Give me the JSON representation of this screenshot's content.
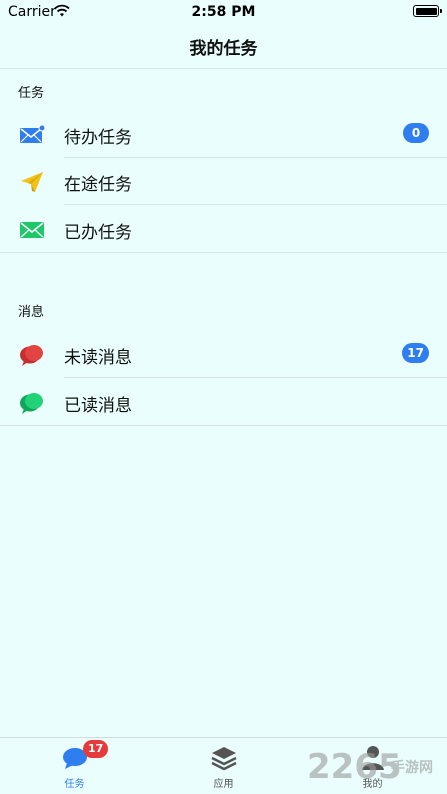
{
  "status_bar": {
    "carrier": "Carrier",
    "time": "2:58 PM"
  },
  "nav": {
    "title": "我的任务"
  },
  "sections": {
    "tasks": {
      "header": "任务",
      "items": [
        {
          "label": "待办任务",
          "icon": "envelope-icon",
          "badge": "0"
        },
        {
          "label": "在途任务",
          "icon": "paper-plane-icon"
        },
        {
          "label": "已办任务",
          "icon": "mail-icon"
        }
      ]
    },
    "messages": {
      "header": "消息",
      "items": [
        {
          "label": "未读消息",
          "icon": "chat-bubbles-red-icon",
          "badge": "17"
        },
        {
          "label": "已读消息",
          "icon": "chat-bubbles-green-icon"
        }
      ]
    }
  },
  "tab_bar": {
    "tabs": [
      {
        "label": "任务",
        "icon": "chat-icon",
        "badge": "17",
        "active": true
      },
      {
        "label": "应用",
        "icon": "layers-icon"
      },
      {
        "label": "我的",
        "icon": "person-icon"
      }
    ]
  },
  "watermark": {
    "text": "2265",
    "sub": "手游网"
  },
  "colors": {
    "accent": "#2f7ef0",
    "background": "#e9fefd",
    "badge_red": "#e53b3b"
  }
}
